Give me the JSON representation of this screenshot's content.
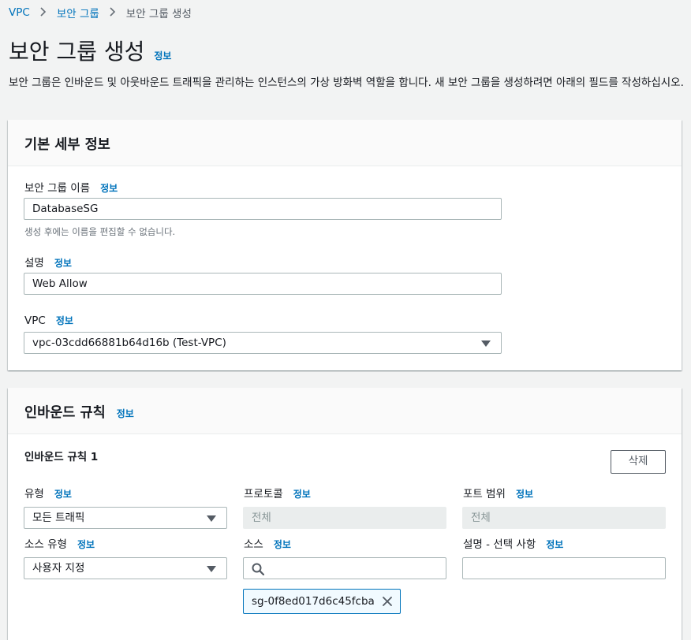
{
  "breadcrumb": [
    "VPC",
    "보안 그룹",
    "보안 그룹 생성"
  ],
  "page": {
    "title": "보안 그룹 생성",
    "info_link": "정보",
    "description": "보안 그룹은 인바운드 및 아웃바운드 트래픽을 관리하는 인스턴스의 가상 방화벽 역할을 합니다. 새 보안 그룹을 생성하려면 아래의 필드를 작성하십시오."
  },
  "basic": {
    "heading": "기본 세부 정보",
    "name_label": "보안 그룹 이름",
    "name_value": "DatabaseSG",
    "name_hint": "생성 후에는 이름을 편집할 수 없습니다.",
    "desc_label": "설명",
    "desc_value": "Web Allow",
    "vpc_label": "VPC",
    "vpc_value": "vpc-03cdd66881b64d16b (Test-VPC)"
  },
  "inbound": {
    "heading": "인바운드 규칙",
    "rule_title": "인바운드 규칙 1",
    "delete_label": "삭제",
    "type_label": "유형",
    "type_value": "모든 트래픽",
    "protocol_label": "프로토콜",
    "protocol_value": "전체",
    "port_label": "포트 범위",
    "port_value": "전체",
    "source_type_label": "소스 유형",
    "source_type_value": "사용자 지정",
    "source_label": "소스",
    "source_value": "",
    "source_token": "sg-0f8ed017d6c45fcba",
    "rule_desc_label": "설명 - 선택 사항",
    "rule_desc_value": ""
  },
  "info": "정보",
  "colors": {
    "link": "#0073bb",
    "background": "#f2f3f3"
  }
}
